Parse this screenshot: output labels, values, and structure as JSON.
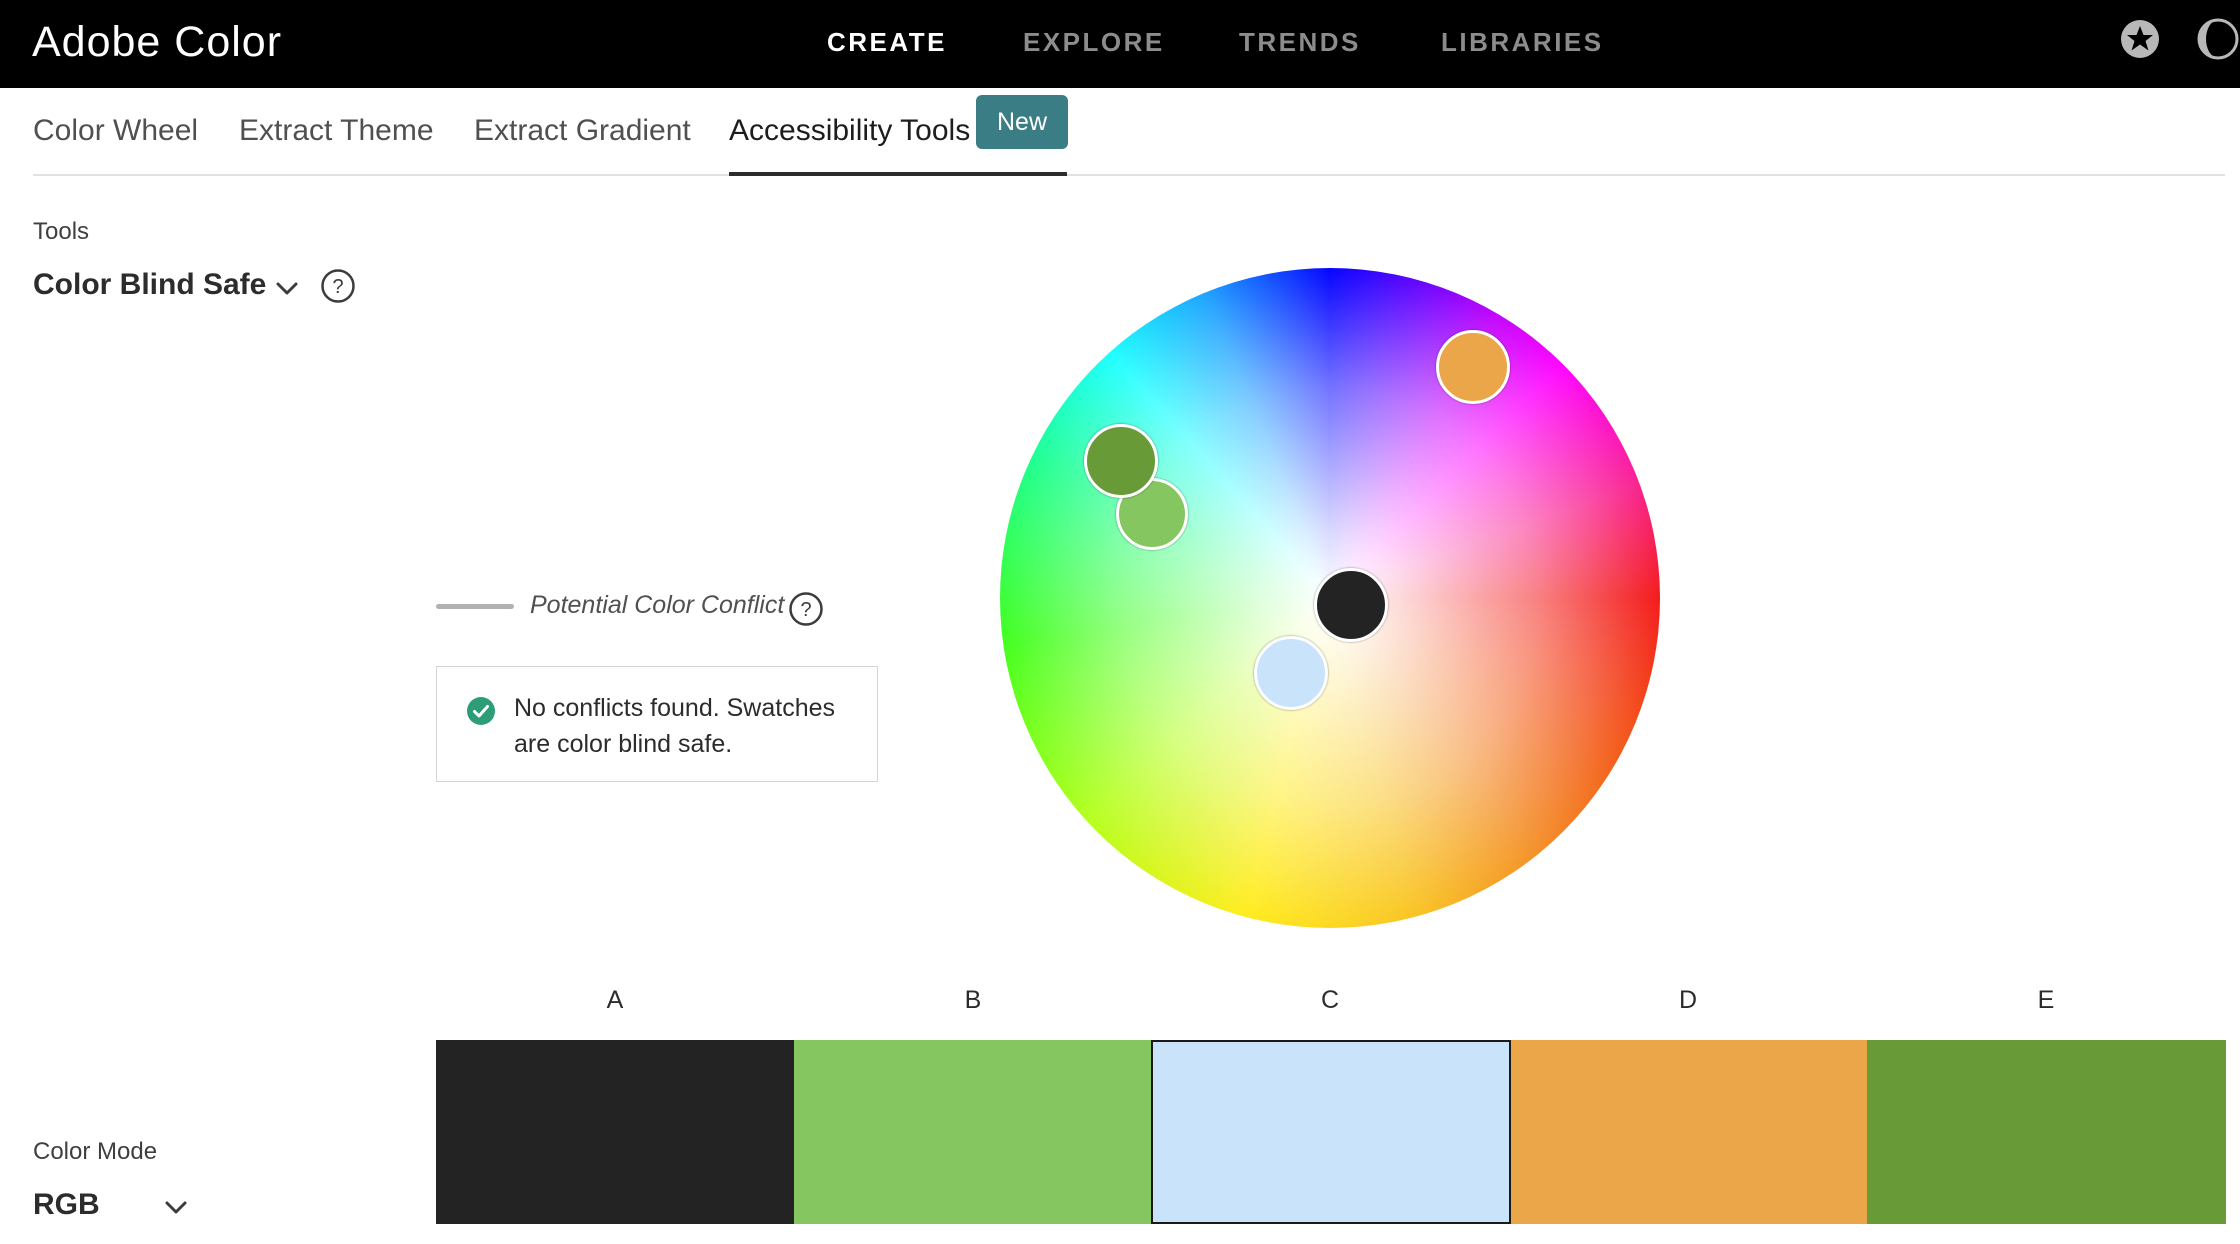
{
  "app": {
    "title": "Adobe Color"
  },
  "topnav": {
    "items": [
      "CREATE",
      "EXPLORE",
      "TRENDS",
      "LIBRARIES"
    ],
    "active": "CREATE"
  },
  "topicons": [
    "star-badge-icon",
    "theme-toggle-icon"
  ],
  "subtabs": {
    "items": [
      "Color Wheel",
      "Extract Theme",
      "Extract Gradient",
      "Accessibility Tools"
    ],
    "active": "Accessibility Tools",
    "new_badge": "New"
  },
  "tools": {
    "label": "Tools",
    "selected": "Color Blind Safe"
  },
  "conflict": {
    "legend": "Potential Color Conflict",
    "message": "No conflicts found. Swatches are color blind safe."
  },
  "color_mode": {
    "label": "Color Mode",
    "selected": "RGB"
  },
  "swatches": [
    {
      "label": "A",
      "color": "#232323"
    },
    {
      "label": "B",
      "color": "#85c660"
    },
    {
      "label": "C",
      "color": "#c8e3fa"
    },
    {
      "label": "D",
      "color": "#eaa648"
    },
    {
      "label": "E",
      "color": "#689a37"
    }
  ],
  "selected_swatch": "C",
  "colors": {
    "accent": "#3a7d84",
    "success": "#2d9d78",
    "topbar": "#000000"
  }
}
